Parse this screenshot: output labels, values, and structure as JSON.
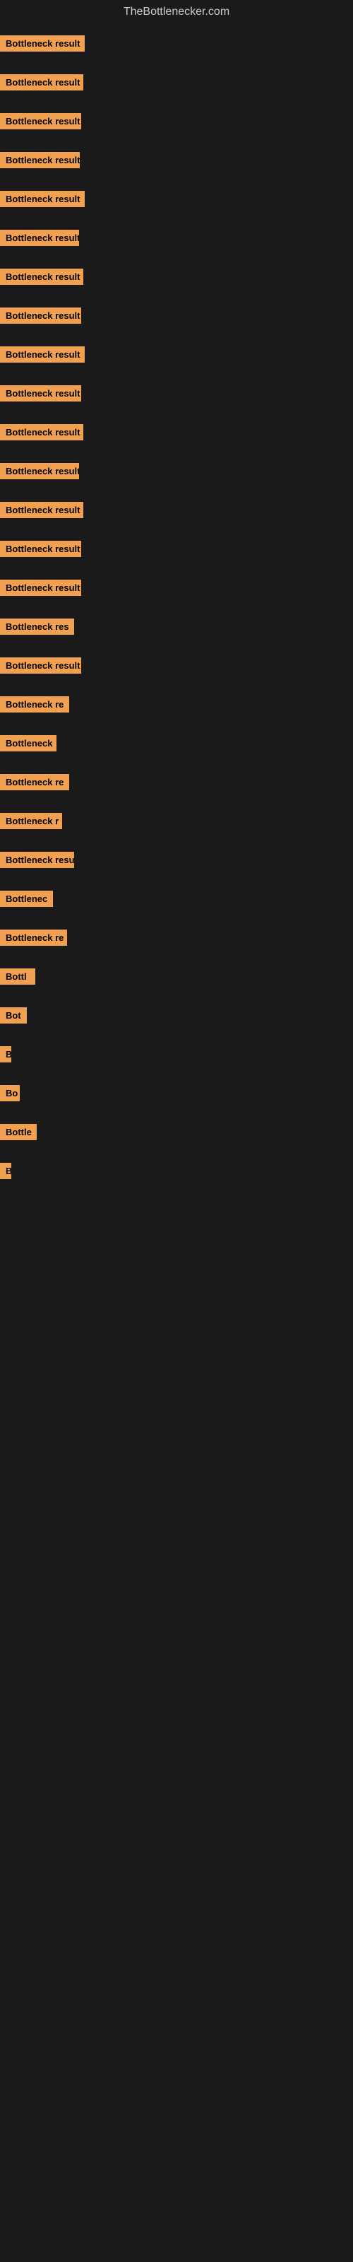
{
  "site": {
    "title": "TheBottlenecker.com"
  },
  "bars": [
    {
      "label": "Bottleneck result",
      "width": 120
    },
    {
      "label": "Bottleneck result",
      "width": 118
    },
    {
      "label": "Bottleneck result",
      "width": 115
    },
    {
      "label": "Bottleneck result",
      "width": 113
    },
    {
      "label": "Bottleneck result",
      "width": 120
    },
    {
      "label": "Bottleneck result",
      "width": 112
    },
    {
      "label": "Bottleneck result",
      "width": 118
    },
    {
      "label": "Bottleneck result",
      "width": 115
    },
    {
      "label": "Bottleneck result",
      "width": 120
    },
    {
      "label": "Bottleneck result",
      "width": 115
    },
    {
      "label": "Bottleneck result",
      "width": 118
    },
    {
      "label": "Bottleneck result",
      "width": 112
    },
    {
      "label": "Bottleneck result",
      "width": 118
    },
    {
      "label": "Bottleneck result",
      "width": 115
    },
    {
      "label": "Bottleneck result",
      "width": 115
    },
    {
      "label": "Bottleneck res",
      "width": 105
    },
    {
      "label": "Bottleneck result",
      "width": 115
    },
    {
      "label": "Bottleneck re",
      "width": 98
    },
    {
      "label": "Bottleneck",
      "width": 80
    },
    {
      "label": "Bottleneck re",
      "width": 98
    },
    {
      "label": "Bottleneck r",
      "width": 88
    },
    {
      "label": "Bottleneck resu",
      "width": 105
    },
    {
      "label": "Bottlenec",
      "width": 75
    },
    {
      "label": "Bottleneck re",
      "width": 95
    },
    {
      "label": "Bottl",
      "width": 50
    },
    {
      "label": "Bot",
      "width": 38
    },
    {
      "label": "B",
      "width": 16
    },
    {
      "label": "Bo",
      "width": 28
    },
    {
      "label": "Bottle",
      "width": 52
    },
    {
      "label": "B",
      "width": 14
    }
  ]
}
